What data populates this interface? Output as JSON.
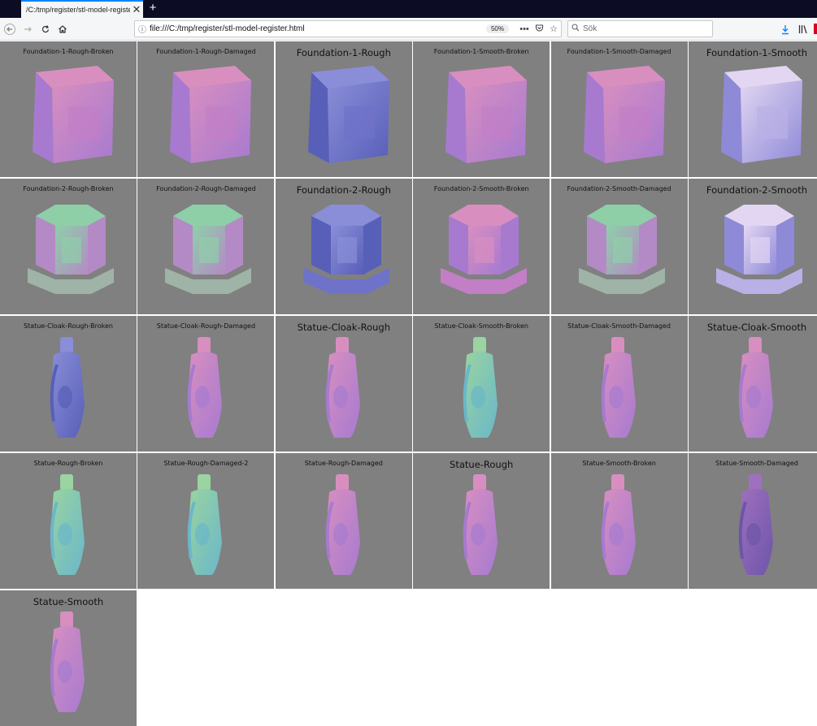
{
  "browser": {
    "tab_title": "/C:/tmp/register/stl-model-register",
    "close_glyph": "✕",
    "new_tab_glyph": "+",
    "url": "file:///C:/tmp/register/stl-model-register.html",
    "zoom": "50%",
    "search_placeholder": "Sök",
    "icons": {
      "back": "back-arrow-icon",
      "forward": "forward-arrow-icon",
      "reload": "reload-icon",
      "home": "home-icon",
      "info": "info-icon",
      "more": "more-dots-icon",
      "pocket": "pocket-icon",
      "bookmark": "star-icon",
      "search": "search-icon",
      "download": "download-icon",
      "library": "library-icon"
    },
    "accent_color": "#0a84ff",
    "tabbar_color": "#0c0c24"
  },
  "models": [
    {
      "label": "Foundation-1-Rough-Broken",
      "big": false,
      "shape": "cube",
      "tint": "pink"
    },
    {
      "label": "Foundation-1-Rough-Damaged",
      "big": false,
      "shape": "cube",
      "tint": "pink"
    },
    {
      "label": "Foundation-1-Rough",
      "big": true,
      "shape": "cube",
      "tint": "blue"
    },
    {
      "label": "Foundation-1-Smooth-Broken",
      "big": false,
      "shape": "cube",
      "tint": "pink"
    },
    {
      "label": "Foundation-1-Smooth-Damaged",
      "big": false,
      "shape": "cube",
      "tint": "pink"
    },
    {
      "label": "Foundation-1-Smooth",
      "big": true,
      "shape": "cube",
      "tint": "lavender"
    },
    {
      "label": "Foundation-2-Rough-Broken",
      "big": false,
      "shape": "octa",
      "tint": "mixed"
    },
    {
      "label": "Foundation-2-Rough-Damaged",
      "big": false,
      "shape": "octa",
      "tint": "mixed"
    },
    {
      "label": "Foundation-2-Rough",
      "big": true,
      "shape": "octa",
      "tint": "blue"
    },
    {
      "label": "Foundation-2-Smooth-Broken",
      "big": false,
      "shape": "octa",
      "tint": "pink"
    },
    {
      "label": "Foundation-2-Smooth-Damaged",
      "big": false,
      "shape": "octa",
      "tint": "mixed"
    },
    {
      "label": "Foundation-2-Smooth",
      "big": true,
      "shape": "octa",
      "tint": "lavender"
    },
    {
      "label": "Statue-Cloak-Rough-Broken",
      "big": false,
      "shape": "statue",
      "tint": "blue"
    },
    {
      "label": "Statue-Cloak-Rough-Damaged",
      "big": false,
      "shape": "statue",
      "tint": "pink"
    },
    {
      "label": "Statue-Cloak-Rough",
      "big": true,
      "shape": "statue",
      "tint": "pink"
    },
    {
      "label": "Statue-Cloak-Smooth-Broken",
      "big": false,
      "shape": "statue",
      "tint": "green"
    },
    {
      "label": "Statue-Cloak-Smooth-Damaged",
      "big": false,
      "shape": "statue",
      "tint": "pink"
    },
    {
      "label": "Statue-Cloak-Smooth",
      "big": true,
      "shape": "statue",
      "tint": "pink"
    },
    {
      "label": "Statue-Rough-Broken",
      "big": false,
      "shape": "statue",
      "tint": "green"
    },
    {
      "label": "Statue-Rough-Damaged-2",
      "big": false,
      "shape": "statue",
      "tint": "green"
    },
    {
      "label": "Statue-Rough-Damaged",
      "big": false,
      "shape": "statue",
      "tint": "pink"
    },
    {
      "label": "Statue-Rough",
      "big": true,
      "shape": "statue",
      "tint": "pink"
    },
    {
      "label": "Statue-Smooth-Broken",
      "big": false,
      "shape": "statue",
      "tint": "pink"
    },
    {
      "label": "Statue-Smooth-Damaged",
      "big": false,
      "shape": "statue",
      "tint": "purple"
    },
    {
      "label": "Statue-Smooth",
      "big": true,
      "shape": "statue",
      "tint": "pink"
    }
  ]
}
